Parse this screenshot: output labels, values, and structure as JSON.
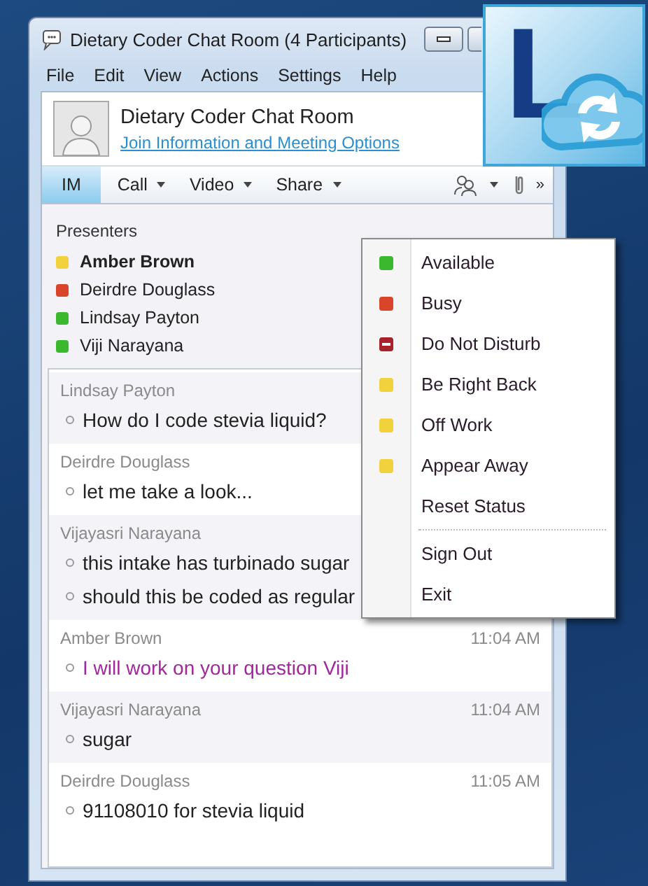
{
  "window": {
    "title": "Dietary Coder Chat Room (4 Participants)"
  },
  "menu_bar": [
    "File",
    "Edit",
    "View",
    "Actions",
    "Settings",
    "Help"
  ],
  "header": {
    "room_name": "Dietary Coder Chat Room",
    "link": "Join Information and Meeting Options"
  },
  "toolbar": {
    "tabs": [
      {
        "label": "IM",
        "selected": true,
        "dropdown": false
      },
      {
        "label": "Call",
        "selected": false,
        "dropdown": true
      },
      {
        "label": "Video",
        "selected": false,
        "dropdown": true
      },
      {
        "label": "Share",
        "selected": false,
        "dropdown": true
      }
    ],
    "overflow": "»"
  },
  "presenters": {
    "heading": "Presenters",
    "people": [
      {
        "name": "Amber Brown",
        "color": "#f2d23c",
        "bold": true
      },
      {
        "name": "Deirdre Douglass",
        "color": "#d9452b",
        "bold": false
      },
      {
        "name": "Lindsay Payton",
        "color": "#3cb82e",
        "bold": false
      },
      {
        "name": "Viji Narayana",
        "color": "#3cb82e",
        "bold": false
      }
    ]
  },
  "messages": [
    {
      "sender": "Lindsay Payton",
      "lines": [
        "How do I code stevia liquid?"
      ],
      "color": "#222222"
    },
    {
      "sender": "Deirdre Douglass",
      "lines": [
        "let me take a look..."
      ],
      "color": "#222222"
    },
    {
      "sender": "Vijayasri Narayana",
      "lines": [
        "this intake has turbinado sugar",
        "should this be coded as regular"
      ],
      "color": "#222222"
    },
    {
      "sender": "Amber Brown",
      "time": "11:04 AM",
      "lines": [
        "I will work on your question Viji"
      ],
      "color": "#a0289a"
    },
    {
      "sender": "Vijayasri Narayana",
      "time": "11:04 AM",
      "lines": [
        "sugar"
      ],
      "color": "#222222"
    },
    {
      "sender": "Deirdre Douglass",
      "time": "11:05 AM",
      "lines": [
        "91108010 for stevia liquid"
      ],
      "color": "#222222"
    }
  ],
  "status_menu": [
    {
      "kind": "status",
      "label": "Available",
      "color": "#3cb82e"
    },
    {
      "kind": "status",
      "label": "Busy",
      "color": "#d9452b"
    },
    {
      "kind": "dnd",
      "label": "Do Not Disturb",
      "color": "#a8202a"
    },
    {
      "kind": "status",
      "label": "Be Right Back",
      "color": "#f2d23c"
    },
    {
      "kind": "status",
      "label": "Off Work",
      "color": "#f2d23c"
    },
    {
      "kind": "status",
      "label": "Appear Away",
      "color": "#f2d23c"
    },
    {
      "kind": "action",
      "label": "Reset Status"
    },
    {
      "kind": "separator"
    },
    {
      "kind": "action",
      "label": "Sign Out"
    },
    {
      "kind": "action",
      "label": "Exit"
    }
  ],
  "logo": {
    "letter": "L"
  }
}
